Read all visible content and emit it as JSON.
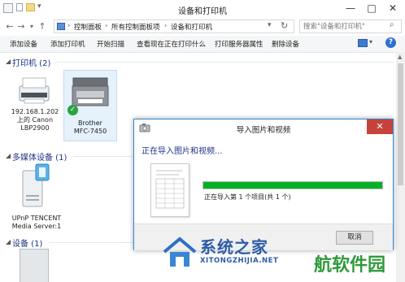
{
  "window": {
    "title": "设备和打印机",
    "controls": {
      "minimize": "—",
      "maximize": "□",
      "close": "✕"
    }
  },
  "address": {
    "segments": [
      "控制面板",
      "所有控制面板项",
      "设备和打印机"
    ],
    "separator": "›",
    "search_placeholder": "搜索\"设备和打印机\""
  },
  "commands": [
    "添加设备",
    "添加打印机",
    "开始扫描",
    "查看现在正在打印什么",
    "打印服务器属性",
    "删除设备"
  ],
  "groups": {
    "printers": {
      "label": "打印机 (2)",
      "devices": [
        {
          "line1": "192.168.1.202",
          "line2": "上的 Canon",
          "line3": "LBP2900"
        },
        {
          "line1": "Brother",
          "line2": "MFC-7450"
        }
      ]
    },
    "multimedia": {
      "label": "多媒体设备 (1)",
      "devices": [
        {
          "line1": "UPnP TENCENT",
          "line2": "Media Server:1"
        }
      ]
    },
    "devices": {
      "label": "设备 (1)"
    }
  },
  "dialog": {
    "title": "导入图片和视频",
    "heading": "正在导入图片和视频...",
    "status": "正在导入第 1 个项目(共 1 个)",
    "progress": 1.0,
    "cancel_label": "取消"
  },
  "watermark": {
    "brand": "系统之家",
    "domain": "XITONGZHIJIA.NET",
    "right_text": "航软件园"
  },
  "colors": {
    "accent": "#1e3287",
    "progress": "#06b025",
    "close_red": "#c7423a",
    "dialog_border": "#2e8bd8",
    "watermark_green": "#2f9a3a"
  }
}
